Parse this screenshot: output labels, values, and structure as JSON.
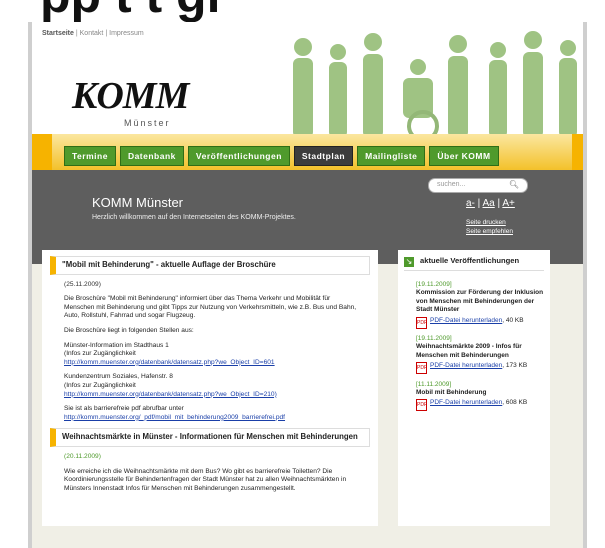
{
  "page_top_cut_text": "pp t t gi",
  "top_links": {
    "home": "Startseite",
    "sep1": "|",
    "contact": "Kontakt",
    "sep2": "|",
    "impressum": "Impressum"
  },
  "logo": {
    "main": "KOMM",
    "city": "Münster"
  },
  "nav": [
    "Termine",
    "Datenbank",
    "Veröffentlichungen",
    "Stadtplan",
    "Mailingliste",
    "Über KOMM"
  ],
  "nav_active": "Stadtplan",
  "banner": {
    "title": "KOMM Münster",
    "subtitle": "Herzlich willkommen auf den Internetseiten des KOMM-Projektes."
  },
  "search": {
    "placeholder": "suchen..."
  },
  "font_size_controls": [
    "a-",
    "Aa",
    "A+"
  ],
  "page_tools": [
    "Seite drucken",
    "Seite empfehlen"
  ],
  "article1": {
    "title": "\"Mobil mit Behinderung\" - aktuelle Auflage der Broschüre",
    "date": "(25.11.2009)",
    "intro": "Die Broschüre \"Mobil mit Behinderung\" informiert über das Thema Verkehr und Mobilität für Menschen mit Behinderung und gibt Tipps zur Nutzung von Verkehrsmitteln, wie z.B. Bus und Bahn, Auto, Rollstuhl, Fahrrad und sogar Flugzeug.",
    "places_intro": "Die Broschüre liegt in folgenden Stellen aus:",
    "place1_name": "Münster-Information im Stadthaus 1",
    "place1_info": "(Infos zur Zugänglichkeit",
    "place1_link": "http://komm.muenster.org/datenbank/datensatz.php?we_Object_ID=601",
    "place2_name": "Kundenzentrum Soziales, Hafenstr. 8",
    "place2_info": "(Infos zur Zugänglichkeit",
    "place2_link": "http://komm.muenster.org/datenbank/datensatz.php?we_Object_ID=210)",
    "pdf_text": "Sie ist als barrierefreie pdf abrufbar unter",
    "pdf_link": "http://komm.muenster.org/_pdf/mobil_mit_behinderung2009_barrierefrei.pdf"
  },
  "article2": {
    "title": "Weihnachtsmärkte in Münster - Informationen für Menschen mit Behinderungen",
    "date": "(20.11.2009)",
    "text": "Wie erreiche ich die Weihnachtsmärkte mit dem Bus? Wo gibt es barrierefreie Toiletten? Die Koordinierungsstelle für Behindertenfragen der Stadt Münster hat zu allen Weihnachtsmärkten in Münsters Innenstadt Infos für Menschen mit Behinderungen zusammengestellt."
  },
  "sidebar": {
    "title": "aktuelle Veröffentlichungen",
    "items": [
      {
        "date": "[19.11.2009]",
        "title": "Kommission zur Förderung der Inklusion von Menschen mit Behinderungen der Stadt Münster",
        "link": "PDF-Datei herunterladen",
        "size": ", 40 KB"
      },
      {
        "date": "[19.11.2009]",
        "title": "Weihnachtsmärkte 2009 - Infos für Menschen mit Behinderungen",
        "link": "PDF-Datei herunterladen",
        "size": ", 173 KB"
      },
      {
        "date": "[11.11.2009]",
        "title": "Mobil mit Behinderung",
        "link": "PDF-Datei herunterladen",
        "size": ", 608 KB"
      }
    ]
  }
}
